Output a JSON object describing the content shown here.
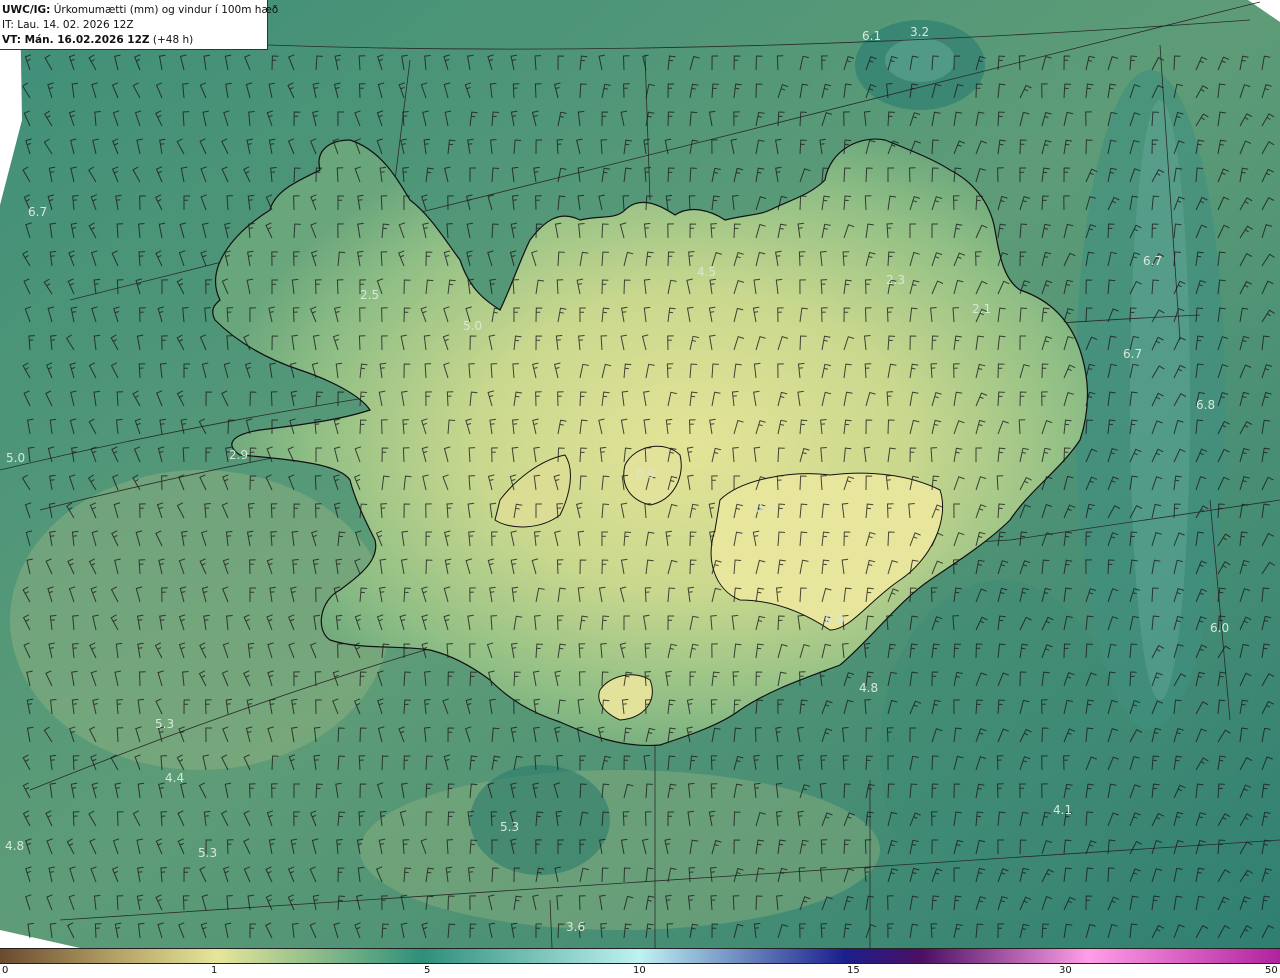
{
  "header": {
    "model_label": "UWC/IG:",
    "title": "Úrkomumætti (mm) og vindur í 100m hæð",
    "it_label": "IT: Lau. 14. 02. 2026 12Z",
    "vt_label": "VT: Mán. 16.02.2026 12Z",
    "vt_offset": "(+48 h)"
  },
  "map": {
    "value_labels": [
      "6.1",
      "3.2",
      "6.7",
      "2.5",
      "5.0",
      "4.5",
      "2.3",
      "2.1",
      "6.7",
      "6.7",
      "6.8",
      "5.0",
      "2.9",
      "0.9",
      "0.7",
      "0.9",
      "6.0",
      "4.8",
      "5.3",
      "4.4",
      "4.8",
      "5.3",
      "5.3",
      "4.1",
      "3.6"
    ]
  },
  "colorbar": {
    "ticks": [
      "0",
      "1",
      "5",
      "10",
      "15",
      "30",
      "50"
    ],
    "colors": [
      "#6b4a2e",
      "#b3a165",
      "#e6e69a",
      "#2e8f7a",
      "#bff2f2",
      "#1a1f8c",
      "#4b0f63",
      "#ff9ee6",
      "#b0229e"
    ]
  }
}
